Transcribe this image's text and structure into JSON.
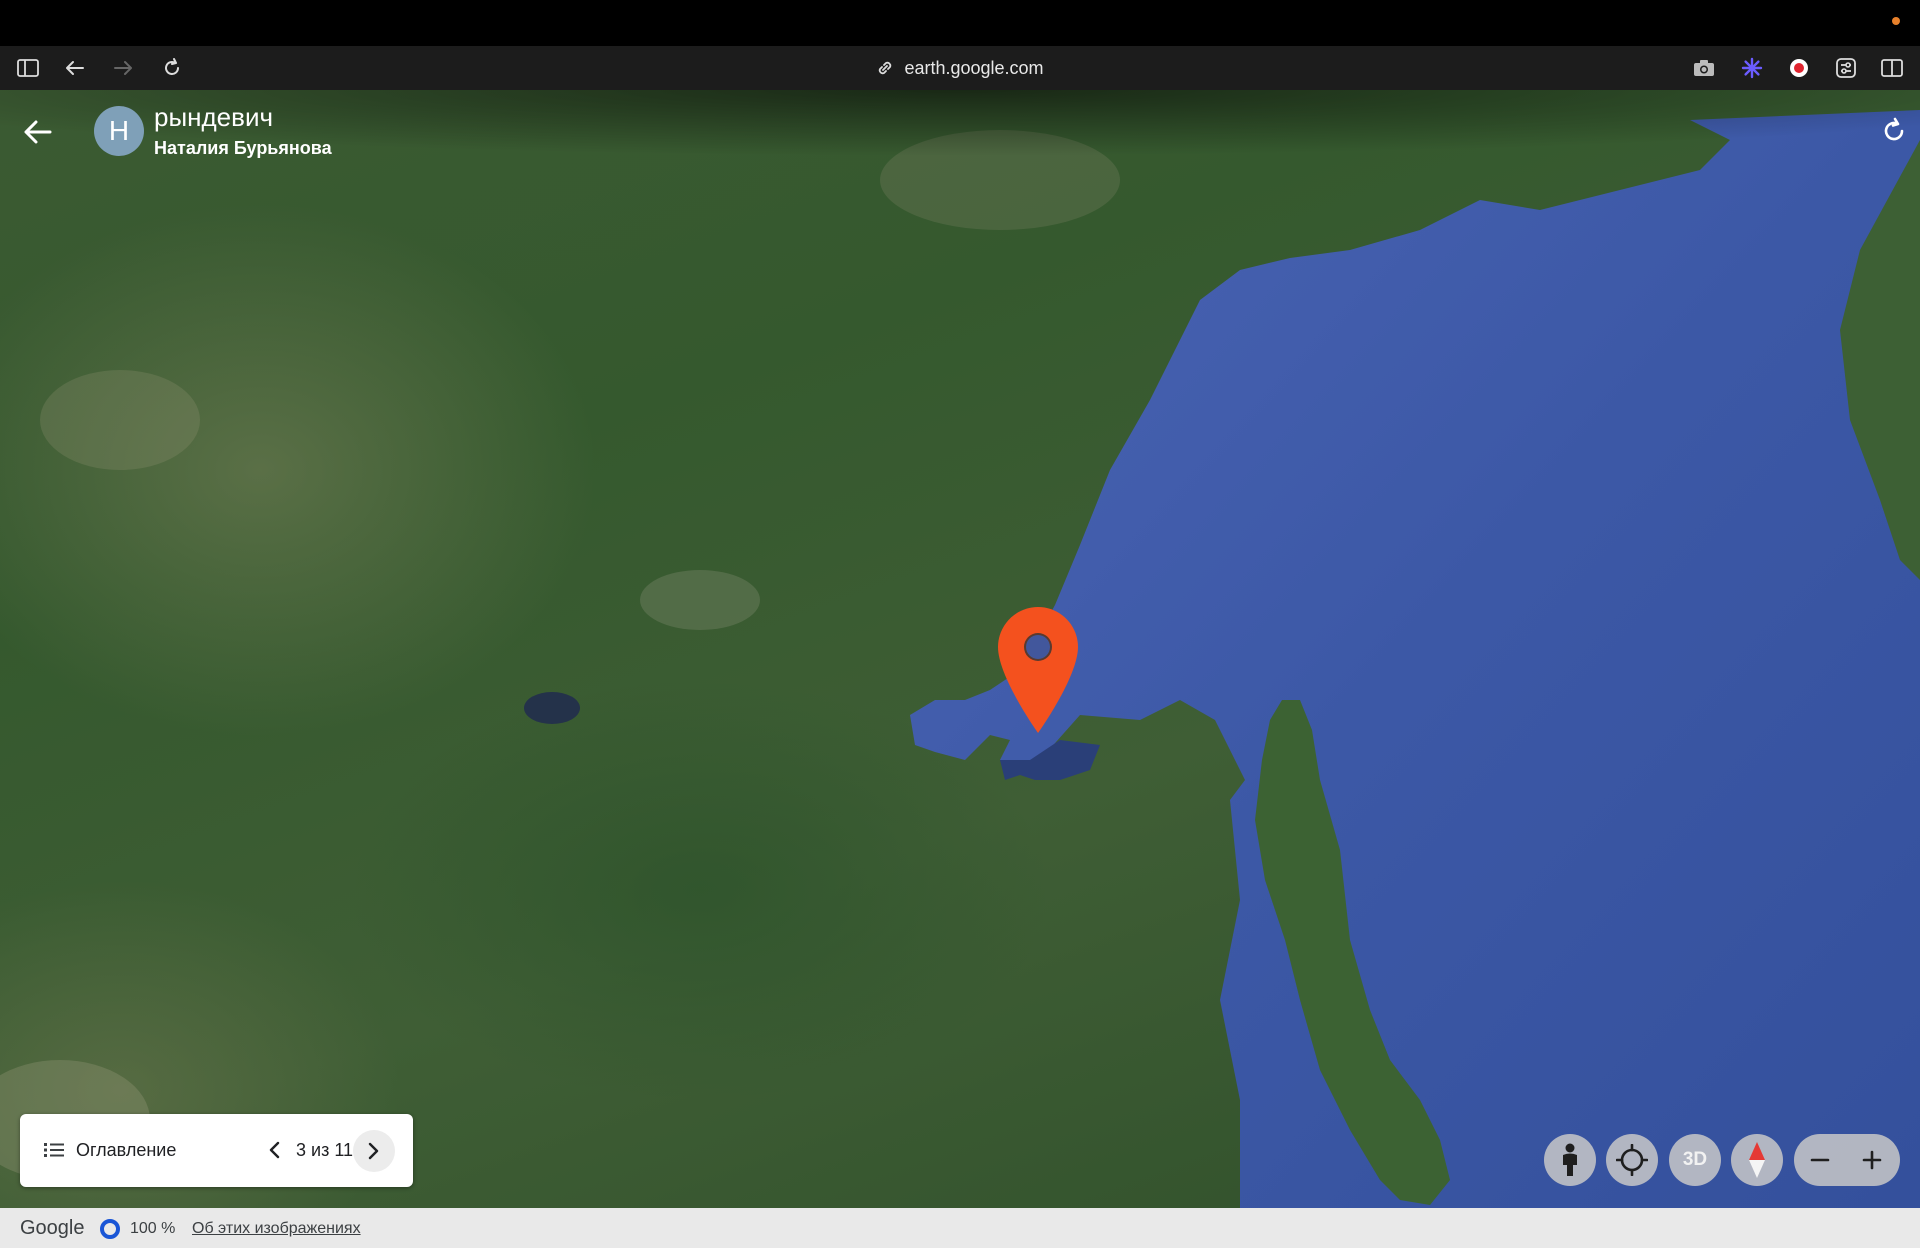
{
  "browser": {
    "url": "earth.google.com"
  },
  "header": {
    "avatar_letter": "Н",
    "title": "рындевич",
    "subtitle": "Наталия Бурьянова"
  },
  "toc": {
    "label": "Оглавление",
    "count": "3 из 11"
  },
  "controls": {
    "mode_3d": "3D"
  },
  "footer": {
    "brand": "Google",
    "zoom_percent": "100 %",
    "about_link": "Об этих изображениях"
  },
  "colors": {
    "pin": "#f4511e",
    "sea": "#3f5ba8",
    "land": "#3b5a32",
    "accent": "#1a56d6"
  },
  "icons": [
    "sidebar-icon",
    "back-arrow-icon",
    "forward-arrow-icon",
    "reload-icon",
    "link-icon",
    "camera-icon",
    "extension-icon",
    "record-icon",
    "settings-icon",
    "split-view-icon",
    "refresh-icon",
    "list-icon",
    "chevron-left-icon",
    "chevron-right-icon",
    "pegman-icon",
    "my-location-icon",
    "compass-icon",
    "zoom-out-icon",
    "zoom-in-icon",
    "location-pin-icon"
  ]
}
